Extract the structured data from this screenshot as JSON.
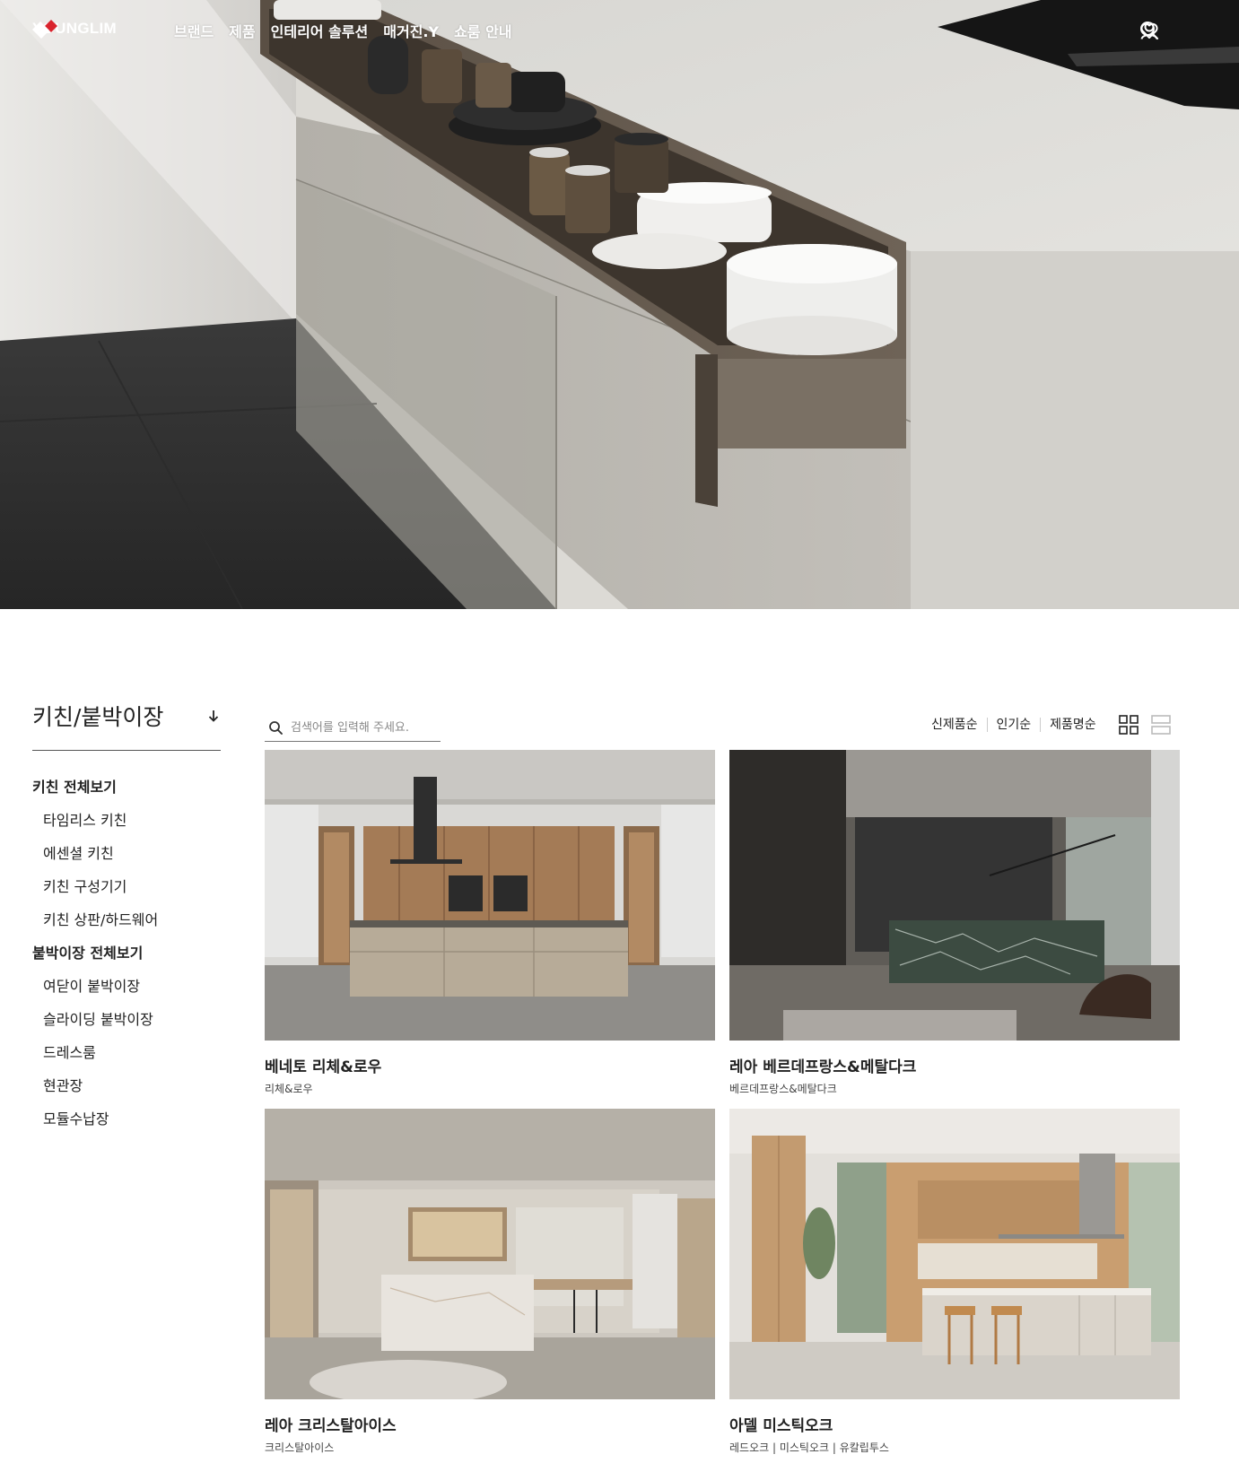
{
  "header": {
    "logo_text": "YOUNGLIM",
    "menu": [
      {
        "label": "브랜드"
      },
      {
        "label": "제품"
      },
      {
        "label": "인테리어 솔루션"
      },
      {
        "label": "매거진.Y"
      },
      {
        "label": "쇼룸 안내"
      }
    ],
    "icons": [
      "search-icon",
      "heart-icon",
      "user-icon"
    ]
  },
  "sidebar": {
    "category_title": "키친/붙박이장",
    "items": [
      {
        "label": "키친 전체보기",
        "type": "group"
      },
      {
        "label": "타임리스 키친",
        "type": "sub"
      },
      {
        "label": "에센셜 키친",
        "type": "sub"
      },
      {
        "label": "키친 구성기기",
        "type": "sub"
      },
      {
        "label": "키친 상판/하드웨어",
        "type": "sub"
      },
      {
        "label": "붙박이장 전체보기",
        "type": "group"
      },
      {
        "label": "여닫이 붙박이장",
        "type": "sub"
      },
      {
        "label": "슬라이딩 붙박이장",
        "type": "sub"
      },
      {
        "label": "드레스룸",
        "type": "sub"
      },
      {
        "label": "현관장",
        "type": "sub"
      },
      {
        "label": "모듈수납장",
        "type": "sub"
      }
    ]
  },
  "search": {
    "placeholder": "검색어를 입력해 주세요.",
    "value": ""
  },
  "sort": {
    "options": [
      "신제품순",
      "인기순",
      "제품명순"
    ]
  },
  "products": [
    {
      "name": "베네토 리체&로우",
      "sub": "리체&로우"
    },
    {
      "name": "레아 베르데프랑스&메탈다크",
      "sub": "베르데프랑스&메탈다크"
    },
    {
      "name": "레아 크리스탈아이스",
      "sub": "크리스탈아이스"
    },
    {
      "name": "아델 미스틱오크",
      "sub": "레드오크 | 미스틱오크 | 유칼립투스"
    }
  ],
  "colors": {
    "brand_red": "#d9232d",
    "text": "#222222"
  }
}
